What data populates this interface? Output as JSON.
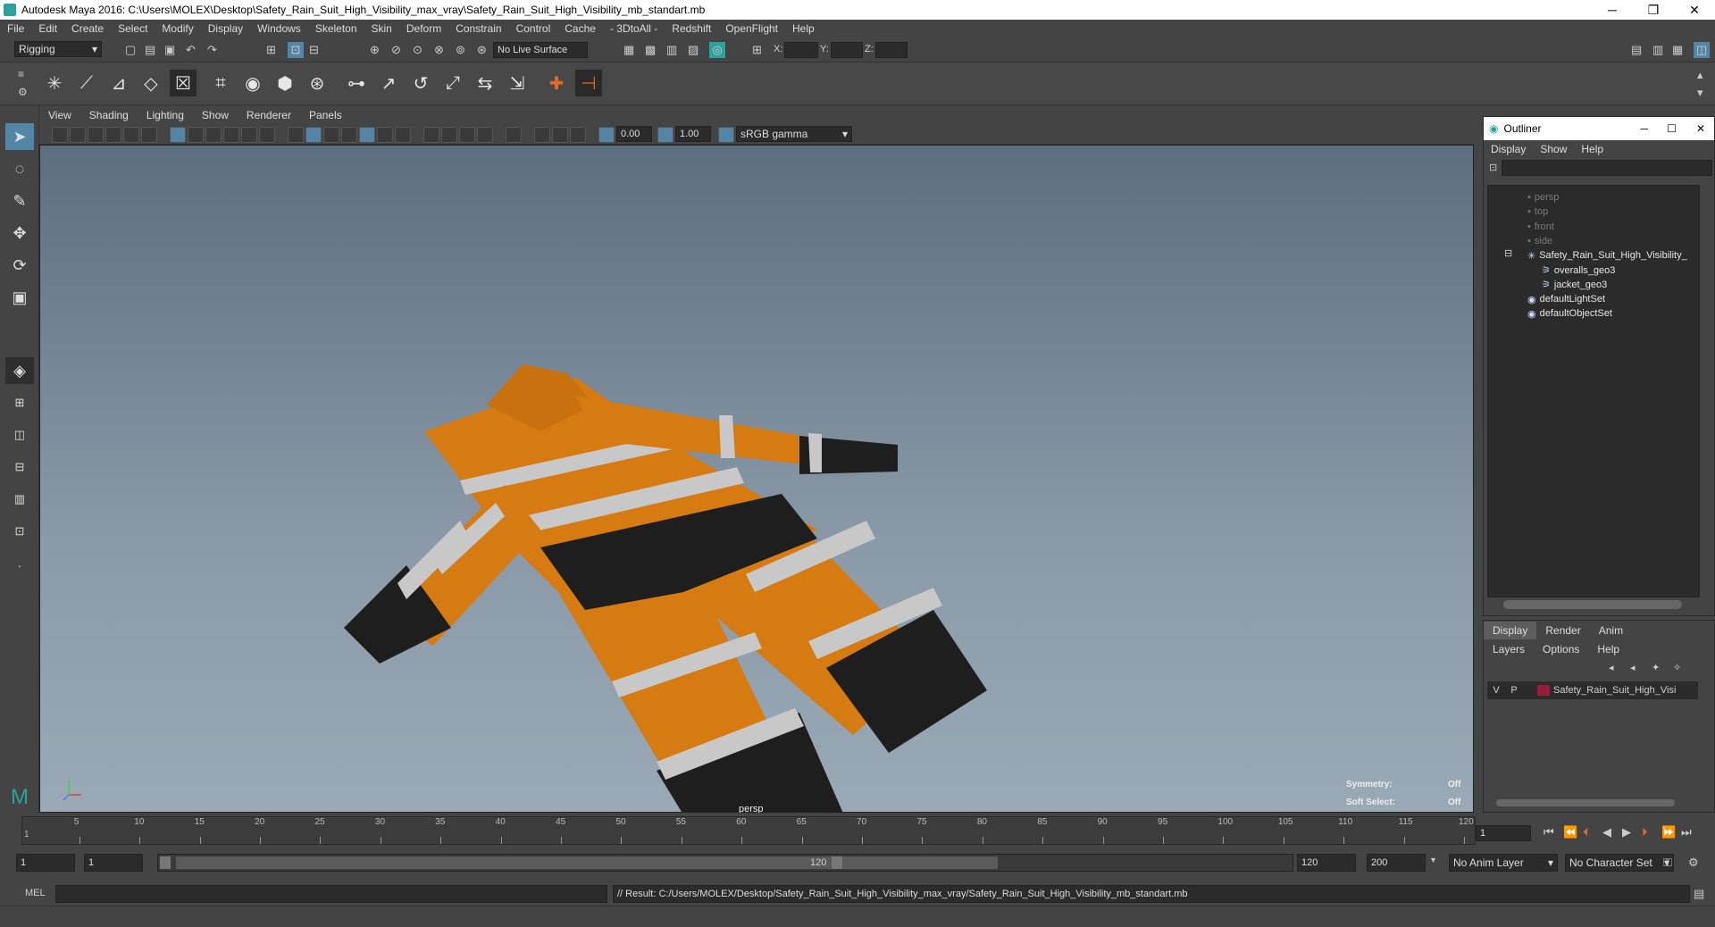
{
  "title_bar": {
    "app_title": "Autodesk Maya 2016: C:\\Users\\MOLEX\\Desktop\\Safety_Rain_Suit_High_Visibility_max_vray\\Safety_Rain_Suit_High_Visibility_mb_standart.mb",
    "minimize": "─",
    "restore": "❐",
    "close": "✕"
  },
  "menu": [
    "File",
    "Edit",
    "Create",
    "Select",
    "Modify",
    "Display",
    "Windows",
    "Skeleton",
    "Skin",
    "Deform",
    "Constrain",
    "Control",
    "Cache",
    "- 3DtoAll -",
    "Redshift",
    "OpenFlight",
    "Help"
  ],
  "status_line": {
    "menu_set": "Rigging",
    "live_surface": "No Live Surface",
    "x_label": "X:",
    "y_label": "Y:",
    "z_label": "Z:"
  },
  "panel_menu": [
    "View",
    "Shading",
    "Lighting",
    "Show",
    "Renderer",
    "Panels"
  ],
  "panel_toolbar": {
    "exposure": "0.00",
    "gamma": "1.00",
    "color_space": "sRGB gamma"
  },
  "viewport": {
    "camera_label": "persp",
    "symmetry_label": "Symmetry:",
    "symmetry_value": "Off",
    "soft_select_label": "Soft Select:",
    "soft_select_value": "Off"
  },
  "outliner": {
    "title": "Outliner",
    "menu": [
      "Display",
      "Show",
      "Help"
    ],
    "items": [
      {
        "label": "persp",
        "dim": true
      },
      {
        "label": "top",
        "dim": true
      },
      {
        "label": "front",
        "dim": true
      },
      {
        "label": "side",
        "dim": true
      },
      {
        "label": "Safety_Rain_Suit_High_Visibility_",
        "dim": false
      },
      {
        "label": "overalls_geo3",
        "dim": false
      },
      {
        "label": "jacket_geo3",
        "dim": false
      },
      {
        "label": "defaultLightSet",
        "dim": false
      },
      {
        "label": "defaultObjectSet",
        "dim": false
      }
    ]
  },
  "layer_editor": {
    "tabs": [
      "Display",
      "Render",
      "Anim"
    ],
    "menu": [
      "Layers",
      "Options",
      "Help"
    ],
    "layer": {
      "visible": "V",
      "playback": "P",
      "name": "Safety_Rain_Suit_High_Visi",
      "color": "#9b1c3a"
    }
  },
  "timeline": {
    "ticks": [
      "5",
      "10",
      "15",
      "20",
      "25",
      "30",
      "35",
      "40",
      "45",
      "50",
      "55",
      "60",
      "65",
      "70",
      "75",
      "80",
      "85",
      "90",
      "95",
      "100",
      "105",
      "110",
      "115",
      "120"
    ],
    "start_marker": "1",
    "current_frame": "1"
  },
  "range_slider": {
    "start": "1",
    "playback_start": "1",
    "range_start_label": "1",
    "range_end_label": "120",
    "playback_end": "120",
    "end": "200",
    "anim_layer": "No Anim Layer",
    "character_set": "No Character Set"
  },
  "command_line": {
    "lang": "MEL",
    "result": "// Result: C:/Users/MOLEX/Desktop/Safety_Rain_Suit_High_Visibility_max_vray/Safety_Rain_Suit_High_Visibility_mb_standart.mb"
  },
  "colors": {
    "accent": "#5285a6",
    "suit_orange": "#d67a12",
    "suit_black": "#1e1e1e",
    "reflective": "#c8c8c8"
  }
}
